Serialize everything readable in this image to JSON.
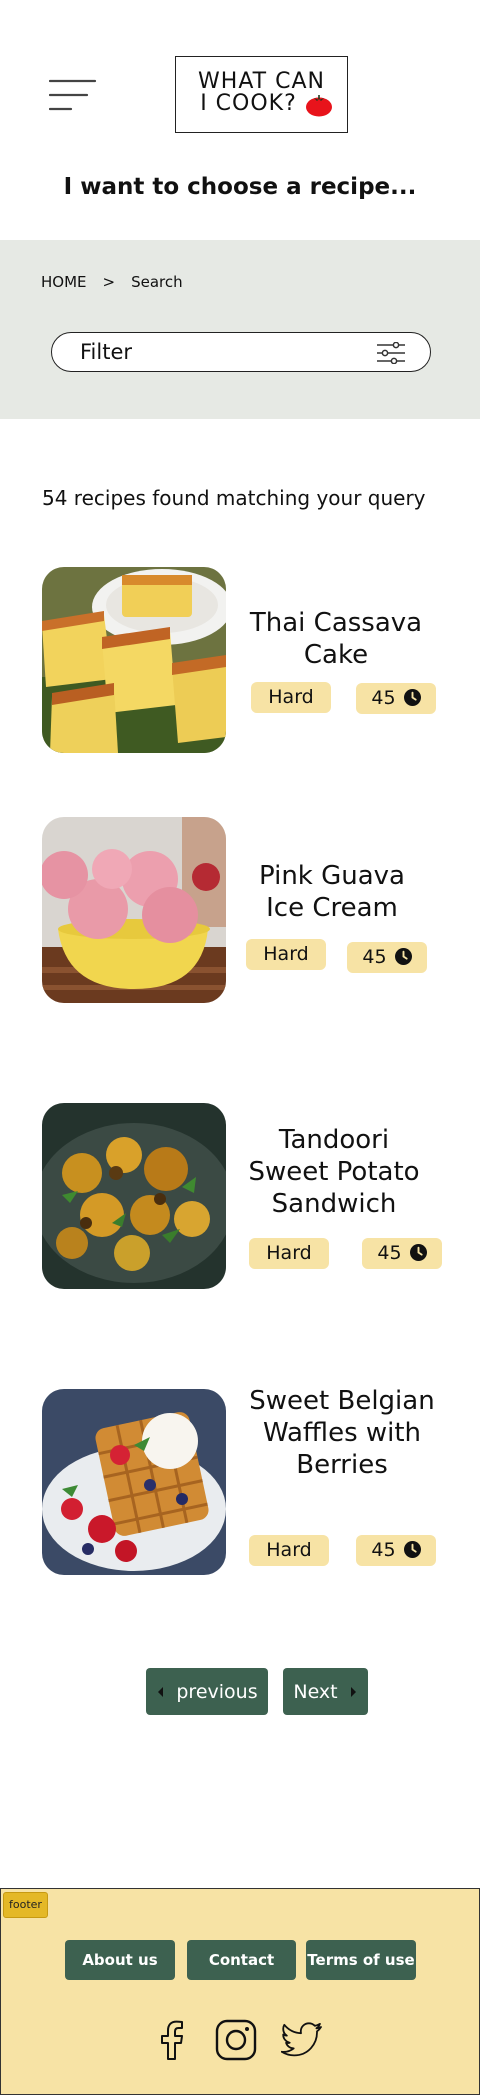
{
  "header": {
    "logo_line1": "WHAT CAN",
    "logo_line2": "I COOK?",
    "heading": "I want to choose a recipe..."
  },
  "breadcrumb": {
    "home": "HOME",
    "separator": ">",
    "current": "Search"
  },
  "search": {
    "placeholder": "Filter",
    "value": ""
  },
  "results": {
    "count_text": "54 recipes found matching your query"
  },
  "recipes": [
    {
      "title": "Thai Cassava Cake",
      "difficulty": "Hard",
      "time": "45",
      "image": "cassava-cake"
    },
    {
      "title": "Pink Guava Ice Cream",
      "difficulty": "Hard",
      "time": "45",
      "image": "ice-cream"
    },
    {
      "title": "Tandoori Sweet Potato Sandwich",
      "difficulty": "Hard",
      "time": "45",
      "image": "tandoori-potato"
    },
    {
      "title": "Sweet Belgian Waffles with Berries",
      "difficulty": "Hard",
      "time": "45",
      "image": "waffles"
    }
  ],
  "pagination": {
    "previous": "previous",
    "next": "Next"
  },
  "footer": {
    "tag": "footer",
    "links": [
      "About us",
      "Contact",
      "Terms of use"
    ],
    "social": [
      "facebook-icon",
      "instagram-icon",
      "twitter-icon"
    ]
  },
  "colors": {
    "accent_green": "#3d6150",
    "pill_yellow": "#f7e3a5",
    "band_grey": "#e6e9e4",
    "tomato_red": "#e8131b"
  }
}
